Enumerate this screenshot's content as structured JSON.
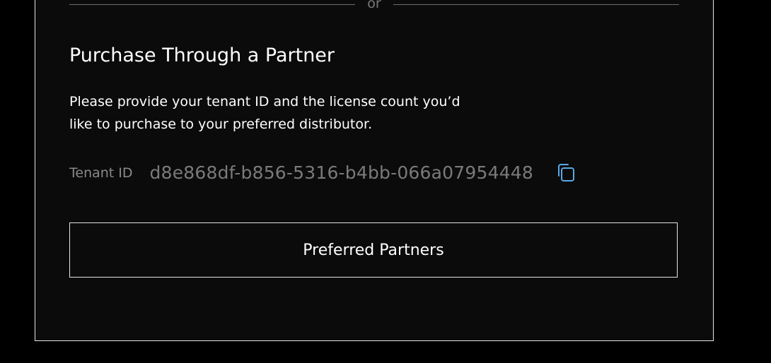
{
  "divider": {
    "text": "or"
  },
  "section": {
    "title": "Purchase Through a Partner",
    "description_line1": "Please provide your tenant ID and the license count you’d",
    "description_line2": "like to purchase to your preferred distributor."
  },
  "tenant": {
    "label": "Tenant ID",
    "value": "d8e868df-b856-5316-b4bb-066a07954448",
    "copy_icon": "copy-icon"
  },
  "actions": {
    "preferred_partners_label": "Preferred Partners"
  },
  "colors": {
    "background": "#000000",
    "panel": "#0b0b0b",
    "accent_icon": "#5aa9e6",
    "muted_text": "#7a7a7a"
  }
}
